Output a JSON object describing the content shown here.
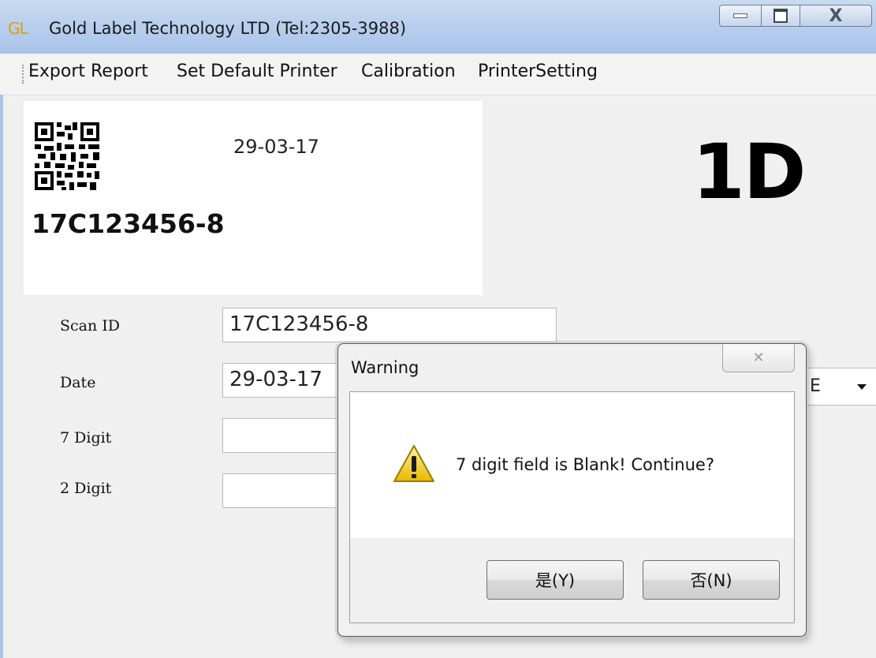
{
  "window": {
    "title": "Gold Label Technology LTD (Tel:2305-3988)",
    "app_logo_text": "GL",
    "controls": {
      "minimize": "minimize-icon",
      "maximize": "maximize-icon",
      "close_glyph": "X"
    }
  },
  "menu": {
    "items": [
      "Export Report",
      "Set Default Printer",
      "Calibration",
      "PrinterSetting"
    ]
  },
  "label_preview": {
    "qr_icon": "qr-code-icon",
    "date": "29-03-17",
    "id": "17C123456-8"
  },
  "mode_label": "1D",
  "form": {
    "scan_id": {
      "label": "Scan ID",
      "value": "17C123456-8"
    },
    "date": {
      "label": "Date",
      "value": "29-03-17"
    },
    "seven_digit": {
      "label": "7 Digit",
      "value": ""
    },
    "two_digit": {
      "label": "2 Digit",
      "value": ""
    },
    "combo_value": "E"
  },
  "dialog": {
    "title": "Warning",
    "close_glyph": "✕",
    "icon": "warning-icon",
    "message": "7 digit field is Blank! Continue?",
    "yes_label": "是(Y)",
    "no_label": "否(N)"
  },
  "colors": {
    "titlebar": "#b9cfee",
    "logo": "#d9a400",
    "window_bg": "#f0f0f0"
  }
}
